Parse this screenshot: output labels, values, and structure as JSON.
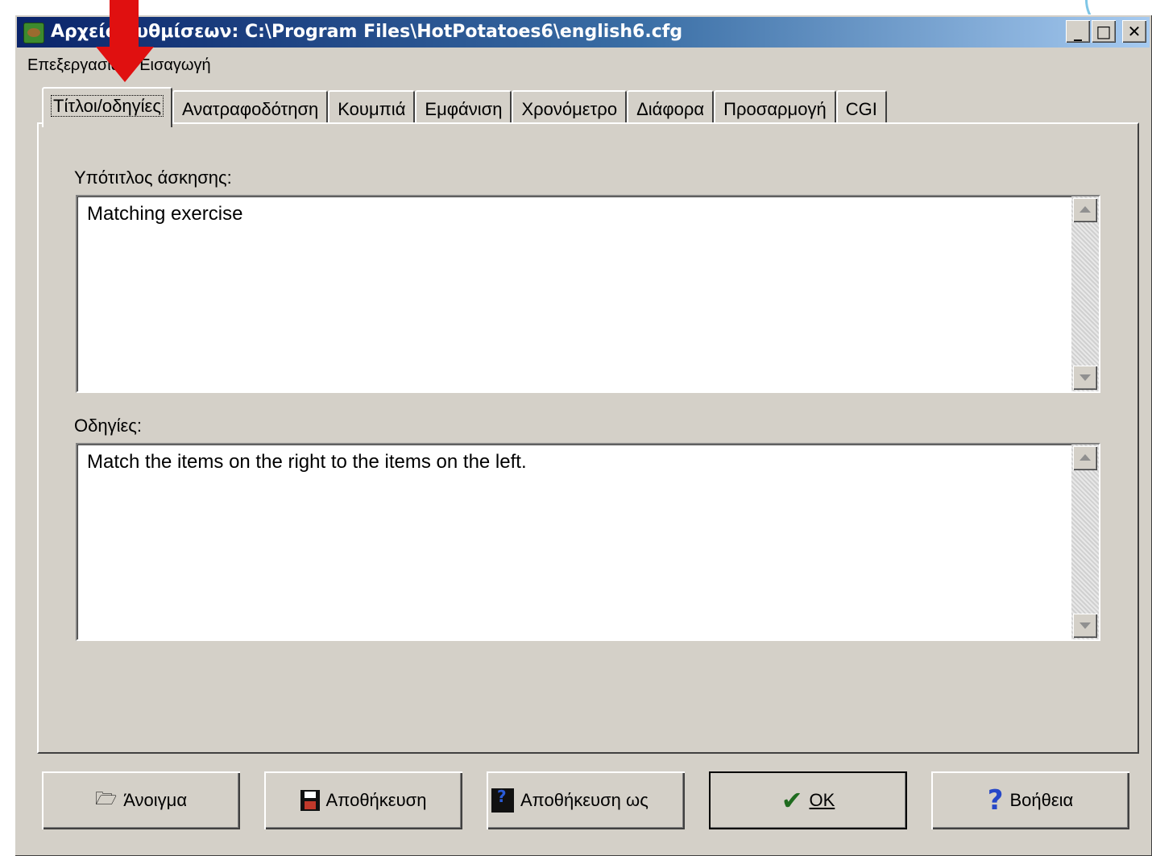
{
  "window": {
    "title": "Αρχείο ρυθμίσεων: C:\\Program Files\\HotPotatoes6\\english6.cfg",
    "minimize_icon": "minimize-icon",
    "maximize_icon": "maximize-icon",
    "close_icon": "close-icon",
    "minimize_glyph": "_",
    "maximize_glyph": "□",
    "close_glyph": "✕"
  },
  "menu": {
    "items": [
      {
        "label": "Επεξεργασία"
      },
      {
        "label": "Εισαγωγή"
      }
    ]
  },
  "tabs": [
    {
      "label": "Τίτλοι/οδηγίες",
      "active": true
    },
    {
      "label": "Ανατραφοδότηση"
    },
    {
      "label": "Κουμπιά"
    },
    {
      "label": "Εμφάνιση"
    },
    {
      "label": "Χρονόμετρο"
    },
    {
      "label": "Διάφορα"
    },
    {
      "label": "Προσαρμογή"
    },
    {
      "label": "CGI"
    }
  ],
  "panel": {
    "subtitle_label": "Υπότιτλος άσκησης:",
    "subtitle_value": "Matching exercise",
    "instructions_label": "Οδηγίες:",
    "instructions_value": "Match the items on the right to the items on the left."
  },
  "buttons": {
    "open": {
      "label": "Άνοιγμα",
      "icon": "folder-icon",
      "glyph": "🗁"
    },
    "save": {
      "label": "Αποθήκευση",
      "icon": "save-icon"
    },
    "save_as": {
      "label": "Αποθήκευση ως",
      "icon": "save-as-icon"
    },
    "ok": {
      "label": "OK",
      "icon": "check-icon",
      "glyph": "✔"
    },
    "help": {
      "label": "Βοήθεια",
      "icon": "help-icon",
      "glyph": "?"
    }
  },
  "colors": {
    "titlebar_start": "#0a246a",
    "titlebar_end": "#a6caf0",
    "window_bg": "#d4d0c8",
    "annotation_arrow": "#e01010"
  }
}
